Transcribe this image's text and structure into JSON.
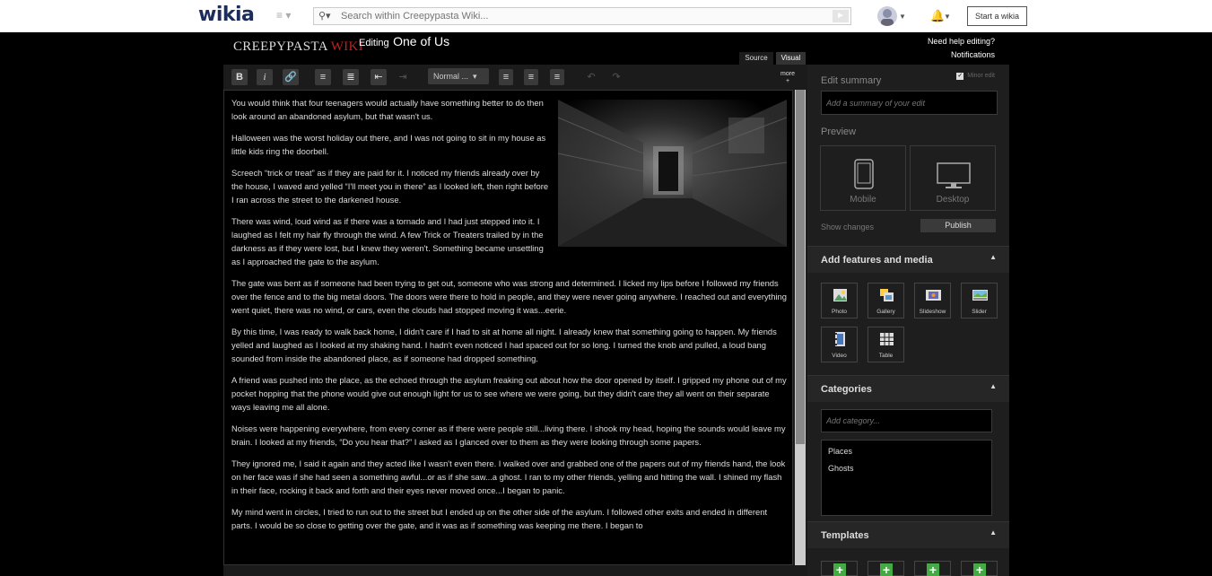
{
  "global_nav": {
    "logo": "wikia",
    "search_placeholder": "Search within Creepypasta Wiki...",
    "start_wiki": "Start a wikia"
  },
  "editor_header": {
    "wiki_wordmark_a": "CREEPYPASTA",
    "wiki_wordmark_b": "WIKI",
    "editing_label": "Editing",
    "page_title": "One of Us",
    "help_link": "Need help editing?",
    "notifications_link": "Notifications",
    "source_tab": "Source",
    "visual_tab": "Visual"
  },
  "toolbar": {
    "bold": "B",
    "italic": "i",
    "format_select": "Normal ...",
    "more_label": "more",
    "more_plus": "+"
  },
  "document": {
    "paragraphs_narrow": [
      "You would think that four teenagers would actually have something better to do then look around an abandoned asylum, but that wasn't us.",
      "Halloween was the worst holiday out there, and I was not going to sit in my house as little kids ring the doorbell.",
      "Screech “trick or treat” as if they are paid for it. I noticed my friends already over by the house, I waved and yelled “I'll meet you in there” as I looked left, then right before I ran across the street to the darkened house.",
      "There was wind, loud wind as if there was a tornado and I had just stepped into it. I laughed as I felt my hair fly through the wind. A few Trick or Treaters trailed by in the darkness as if they were lost, but I knew they weren't. Something became unsettling as I approached the gate to the asylum."
    ],
    "paragraphs_wide": [
      "The gate was bent as if someone had been trying to get out, someone who was strong and determined. I licked my lips before I followed my friends over the fence and to the big metal doors. The doors were there to hold in people, and they were never going anywhere. I reached out and everything went quiet, there was no wind, or cars, even the clouds had stopped moving it was...eerie.",
      "By this time, I was ready to walk back home, I didn't care if I had to sit at home all night. I already knew that something going to happen. My friends yelled and laughed as I looked at my shaking hand. I hadn't even noticed I had spaced out for so long. I turned the knob and pulled, a loud bang sounded from inside the abandoned place, as if someone had dropped something.",
      "A friend was pushed into the place, as the echoed through the asylum freaking out about how the door opened by itself. I gripped my phone out of my pocket hopping that the phone would give out enough light for us to see where we were going, but they didn't care they all went on their separate ways leaving me all alone.",
      "Noises were happening everywhere, from every corner as if there were people still...living there. I shook my head, hoping the sounds would leave my brain. I looked at my friends, “Do you hear that?” I asked as I glanced over to them as they were looking through some papers.",
      "They ignored me, I said it again and they acted like I wasn't even there. I walked over and grabbed one of the papers out of my friends hand, the look on her face was if she had seen a something awful...or as if she saw...a ghost. I ran to my other friends, yelling and hitting the wall. I shined my flash in their face, rocking it back and forth and their eyes never moved once...I began to panic.",
      "My mind went in circles, I tried to run out to the street but I ended up on the other side of the asylum. I followed other exits and ended in different parts. I would be so close to getting over the gate, and it was as if something was keeping me there. I began to"
    ]
  },
  "rail": {
    "edit_summary_label": "Edit summary",
    "minor_edit": "Minor edit",
    "summary_placeholder": "Add a summary of your edit",
    "preview_label": "Preview",
    "mobile": "Mobile",
    "desktop": "Desktop",
    "show_changes": "Show changes",
    "publish": "Publish",
    "add_features": "Add features and media",
    "media": [
      "Photo",
      "Gallery",
      "Slideshow",
      "Slider",
      "Video",
      "Table"
    ],
    "categories_title": "Categories",
    "category_placeholder": "Add category...",
    "categories": [
      "Places",
      "Ghosts"
    ],
    "templates_title": "Templates"
  }
}
